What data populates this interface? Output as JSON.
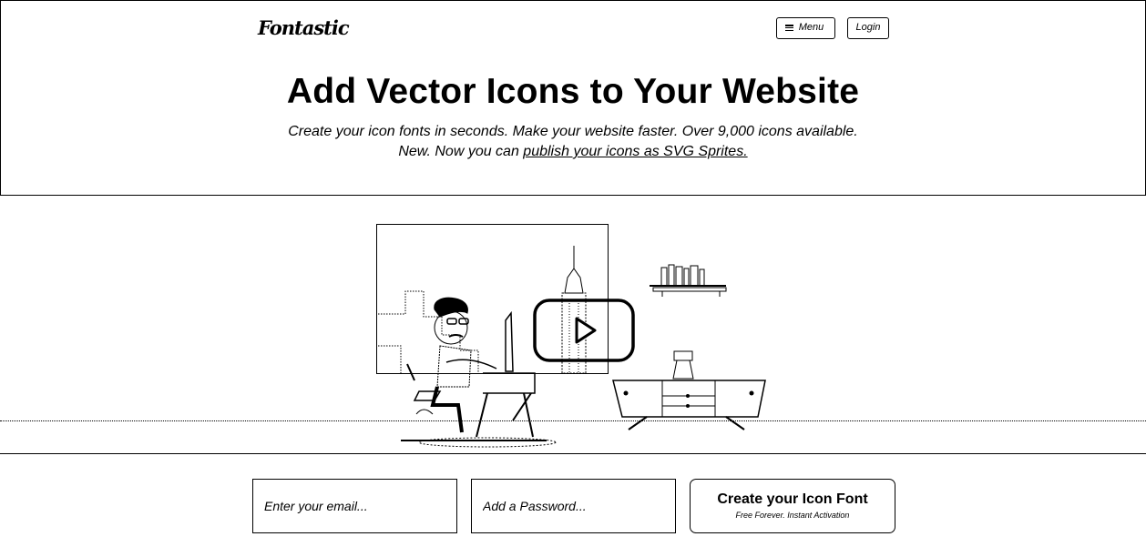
{
  "header": {
    "logo": "Fontastic",
    "menu_label": "Menu",
    "login_label": "Login"
  },
  "hero": {
    "title": "Add Vector Icons to Your Website",
    "subtitle_line1": "Create your icon fonts in seconds. Make your website faster. Over 9,000 icons available.",
    "subtitle_line2_prefix": "New. Now you can ",
    "subtitle_link": "publish your icons as SVG Sprites."
  },
  "illustration": {
    "description_icon": "person-at-desk-illustration",
    "play_icon": "play-icon"
  },
  "signup": {
    "email_placeholder": "Enter your email...",
    "password_placeholder": "Add a Password...",
    "cta_title": "Create your Icon Font",
    "cta_subtitle": "Free Forever. Instant Activation"
  }
}
